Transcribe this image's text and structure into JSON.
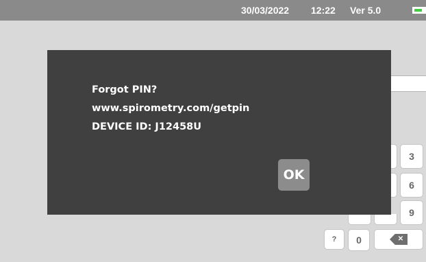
{
  "status_bar": {
    "date": "30/03/2022",
    "time": "12:22",
    "version": "Ver 5.0",
    "battery_icon": "battery-icon",
    "battery_fill_color": "#3fcf3f"
  },
  "keypad": {
    "keys": [
      "3",
      "6",
      "9",
      "?",
      "0"
    ],
    "backspace_glyph": "✕"
  },
  "dialog": {
    "line1": "Forgot PIN?",
    "line2": "www.spirometry.com/getpin",
    "line3": "DEVICE ID: J12458U",
    "ok_label": "OK",
    "background_color": "#404040"
  }
}
